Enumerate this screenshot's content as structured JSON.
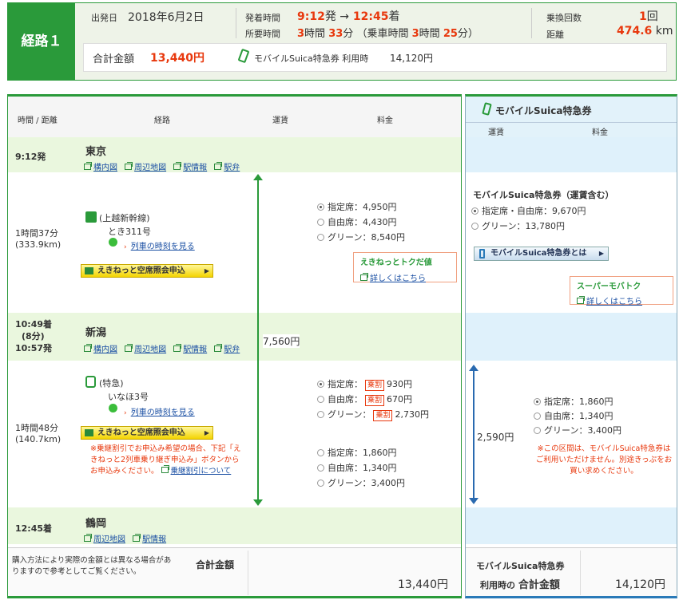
{
  "route": {
    "label": "経路１",
    "date_label": "出発日",
    "date": "2018年6月2日",
    "dep_label": "発着時間",
    "dep_time": "9:12",
    "dep_suffix": "発 →",
    "arr_time": "12:45",
    "arr_suffix": "着",
    "dur_label": "所要時間",
    "dur_h": "3",
    "dur_h_unit": "時間",
    "dur_m": "33",
    "dur_m_unit": "分",
    "ride_prefix": "（乗車時間",
    "ride_h": "3",
    "ride_m": "25",
    "ride_suffix": "分）",
    "transfer_label": "乗換回数",
    "transfer_value": "1",
    "transfer_unit": "回",
    "dist_label": "距離",
    "dist_value": "474.6",
    "dist_unit": "km",
    "total_label": "合計金額",
    "total_value": "13,440円",
    "mobile_label": "モバイルSuica特急券 利用時",
    "mobile_value": "14,120円"
  },
  "headers": {
    "time": "時間 / 距離",
    "route": "経路",
    "fare": "運賃",
    "charge": "料金",
    "mobile_title": "モバイルSuica特急券",
    "m_fare": "運賃",
    "m_charge": "料金"
  },
  "links": {
    "station_map": "構内図",
    "area_map": "周辺地図",
    "station_info": "駅情報",
    "ekiben": "駅弁",
    "timetable": "列車の時刻を見る"
  },
  "stop1": {
    "time": "9:12発",
    "name": "東京"
  },
  "seg1": {
    "duration": "1時間37分",
    "distance": "(333.9km)",
    "line": "(上越新幹線)",
    "train": "とき311号",
    "reserve": "えきねっと空席照会申込",
    "opt1": "指定席：4,950円",
    "opt2": "自由席：4,430円",
    "opt3": "グリーン：8,540円",
    "promo_title": "えきねっとトクだ値",
    "promo_link": "詳しくはこちら",
    "m_title": "モバイルSuica特急券（運賃含む）",
    "m_opt1": "指定席・自由席：9,670円",
    "m_opt2": "グリーン：13,780円",
    "m_btn": "モバイルSuica特急券とは",
    "m_promo_title": "スーパーモバトク",
    "m_promo_link": "詳しくはこちら"
  },
  "stop2": {
    "arr": "10:49着",
    "wait": "(8分)",
    "dep": "10:57発",
    "name": "新潟"
  },
  "fare_total": "7,560円",
  "seg2": {
    "duration": "1時間48分",
    "distance": "(140.7km)",
    "line": "(特急)",
    "train": "いなほ3号",
    "reserve": "えきねっと空席照会申込",
    "note": "※乗継割引でお申込み希望の場合、下記「えきねっと2列車乗り継ぎ申込み」ボタンからお申込みください。",
    "note_link": "乗継割引について",
    "d_label1": "指定席：",
    "d_badge": "乗割",
    "d_price1": "930円",
    "d_label2": "自由席：",
    "d_price2": "670円",
    "d_label3": "グリーン：",
    "d_price3": "2,730円",
    "opt1": "指定席：1,860円",
    "opt2": "自由席：1,340円",
    "opt3": "グリーン：3,400円",
    "m_fare": "2,590円",
    "m_opt1": "指定席：1,860円",
    "m_opt2": "自由席：1,340円",
    "m_opt3": "グリーン：3,400円",
    "m_note": "※この区間は、モバイルSuica特急券はご利用いただけません。別途きっぷをお買い求めください。"
  },
  "stop3": {
    "time": "12:45着",
    "name": "鶴岡"
  },
  "footer": {
    "note": "購入方法により実際の金額とは異なる場合がありますので参考としてご覧ください。",
    "total_label": "合計金額",
    "total": "13,440円",
    "m_label1": "モバイルSuica特急券",
    "m_label2": "利用時の",
    "m_label3": "合計金額",
    "m_total": "14,120円"
  }
}
